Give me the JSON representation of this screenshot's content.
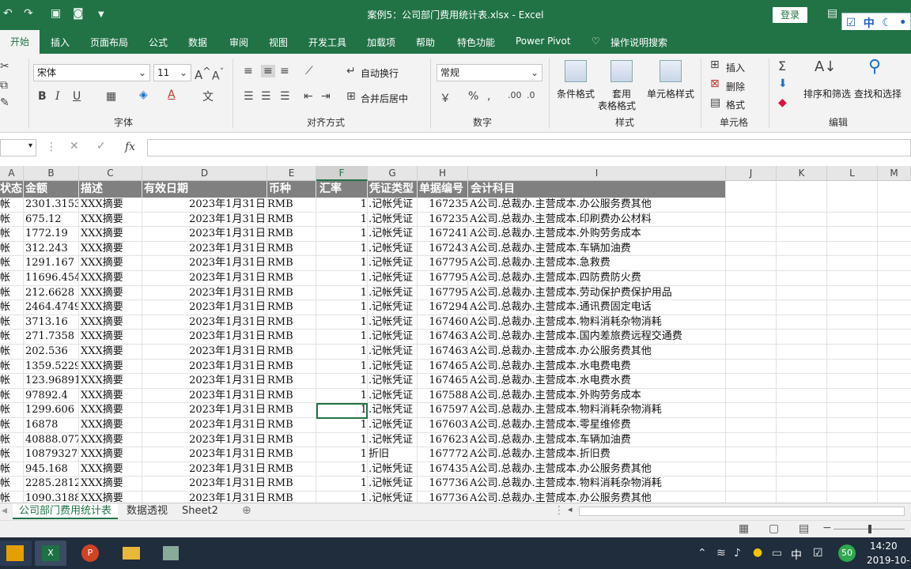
{
  "window": {
    "title": "案例5：公司部门费用统计表.xlsx  -  Excel",
    "login": "登录",
    "ime": [
      "中"
    ]
  },
  "tabs": [
    "开始",
    "插入",
    "页面布局",
    "公式",
    "数据",
    "审阅",
    "视图",
    "开发工具",
    "加载项",
    "帮助",
    "特色功能",
    "Power Pivot",
    "操作说明搜索"
  ],
  "ribbon": {
    "font_name": "宋体",
    "font_size": "11",
    "wrap_text": "自动换行",
    "merge_center": "合并后居中",
    "number_format": "常规",
    "cond_format": "条件格式",
    "table_format_1": "套用",
    "table_format_2": "表格格式",
    "cell_style": "单元格样式",
    "insert": "插入",
    "delete": "删除",
    "format": "格式",
    "sort_filter": "排序和筛选",
    "find_select": "查找和选择",
    "groups": [
      "字体",
      "对齐方式",
      "数字",
      "样式",
      "单元格",
      "编辑"
    ]
  },
  "formula_bar": {
    "fx": "fx"
  },
  "columns": [
    "A",
    "B",
    "C",
    "D",
    "E",
    "F",
    "G",
    "H",
    "I",
    "J",
    "K",
    "L",
    "M"
  ],
  "selected_column": "F",
  "header_row": [
    "状态",
    "金额",
    "描述",
    "有效日期",
    "币种",
    "汇率",
    "凭证类型",
    "单据编号",
    "会计科目"
  ],
  "rows": [
    [
      "帐",
      "2301.3153",
      "XXX摘要",
      "2023年1月31日",
      "RMB",
      "1",
      ".记帐凭证",
      "167235",
      "A公司.总裁办.主营成本.办公服务费其他"
    ],
    [
      "帐",
      "675.12",
      "XXX摘要",
      "2023年1月31日",
      "RMB",
      "1",
      ".记帐凭证",
      "167235",
      "A公司.总裁办.主营成本.印刷费办公材料"
    ],
    [
      "帐",
      "1772.19",
      "XXX摘要",
      "2023年1月31日",
      "RMB",
      "1",
      ".记帐凭证",
      "167241",
      "A公司.总裁办.主营成本.外购劳务成本"
    ],
    [
      "帐",
      "312.243",
      "XXX摘要",
      "2023年1月31日",
      "RMB",
      "1",
      ".记帐凭证",
      "167243",
      "A公司.总裁办.主营成本.车辆加油费"
    ],
    [
      "帐",
      "1291.167",
      "XXX摘要",
      "2023年1月31日",
      "RMB",
      "1",
      ".记帐凭证",
      "167795",
      "A公司.总裁办.主营成本.急救费"
    ],
    [
      "帐",
      "11696.454",
      "XXX摘要",
      "2023年1月31日",
      "RMB",
      "1",
      ".记帐凭证",
      "167795",
      "A公司.总裁办.主营成本.四防费防火费"
    ],
    [
      "帐",
      "212.6628",
      "XXX摘要",
      "2023年1月31日",
      "RMB",
      "1",
      ".记帐凭证",
      "167795",
      "A公司.总裁办.主营成本.劳动保护费保护用品"
    ],
    [
      "帐",
      "2464.4749",
      "XXX摘要",
      "2023年1月31日",
      "RMB",
      "1",
      ".记帐凭证",
      "167294",
      "A公司.总裁办.主营成本.通讯费固定电话"
    ],
    [
      "帐",
      "3713.16",
      "XXX摘要",
      "2023年1月31日",
      "RMB",
      "1",
      ".记帐凭证",
      "167460",
      "A公司.总裁办.主营成本.物料消耗杂物消耗"
    ],
    [
      "帐",
      "271.7358",
      "XXX摘要",
      "2023年1月31日",
      "RMB",
      "1",
      ".记帐凭证",
      "167463",
      "A公司.总裁办.主营成本.国内差旅费远程交通费"
    ],
    [
      "帐",
      "202.536",
      "XXX摘要",
      "2023年1月31日",
      "RMB",
      "1",
      ".记帐凭证",
      "167463",
      "A公司.总裁办.主营成本.办公服务费其他"
    ],
    [
      "帐",
      "1359.5229",
      "XXX摘要",
      "2023年1月31日",
      "RMB",
      "1",
      ".记帐凭证",
      "167465",
      "A公司.总裁办.主营成本.水电费电费"
    ],
    [
      "帐",
      "123.96891",
      "XXX摘要",
      "2023年1月31日",
      "RMB",
      "1",
      ".记帐凭证",
      "167465",
      "A公司.总裁办.主营成本.水电费水费"
    ],
    [
      "帐",
      "97892.4",
      "XXX摘要",
      "2023年1月31日",
      "RMB",
      "1",
      ".记帐凭证",
      "167588",
      "A公司.总裁办.主营成本.外购劳务成本"
    ],
    [
      "帐",
      "1299.606",
      "XXX摘要",
      "2023年1月31日",
      "RMB",
      "1",
      ".记帐凭证",
      "167597",
      "A公司.总裁办.主营成本.物料消耗杂物消耗"
    ],
    [
      "帐",
      "16878",
      "XXX摘要",
      "2023年1月31日",
      "RMB",
      "1",
      ".记帐凭证",
      "167603",
      "A公司.总裁办.主营成本.零星维修费"
    ],
    [
      "帐",
      "40888.077",
      "XXX摘要",
      "2023年1月31日",
      "RMB",
      "1",
      ".记帐凭证",
      "167623",
      "A公司.总裁办.主营成本.车辆加油费"
    ],
    [
      "帐",
      "10879327.",
      "XXX摘要",
      "2023年1月31日",
      "RMB",
      "1",
      "折旧",
      "167772",
      "A公司.总裁办.主营成本.折旧费"
    ],
    [
      "帐",
      "945.168",
      "XXX摘要",
      "2023年1月31日",
      "RMB",
      "1",
      ".记帐凭证",
      "167435",
      "A公司.总裁办.主营成本.办公服务费其他"
    ],
    [
      "帐",
      "2285.2812",
      "XXX摘要",
      "2023年1月31日",
      "RMB",
      "1",
      ".记帐凭证",
      "167736",
      "A公司.总裁办.主营成本.物料消耗杂物消耗"
    ],
    [
      "帐",
      "1090.3188",
      "XXX摘要",
      "2023年1月31日",
      "RMB",
      "1",
      ".记帐凭证",
      "167736",
      "A公司.总裁办.主营成本.办公服务费其他"
    ]
  ],
  "sheets": [
    "公司部门费用统计表",
    "数据透视",
    "Sheet2"
  ],
  "taskbar": {
    "time": "14:20",
    "date": "2019-10-",
    "badge": "50",
    "ime": "中"
  },
  "colors": {
    "excel_green": "#217346",
    "header_gray": "#808080",
    "taskbar": "#1f2d3d"
  }
}
